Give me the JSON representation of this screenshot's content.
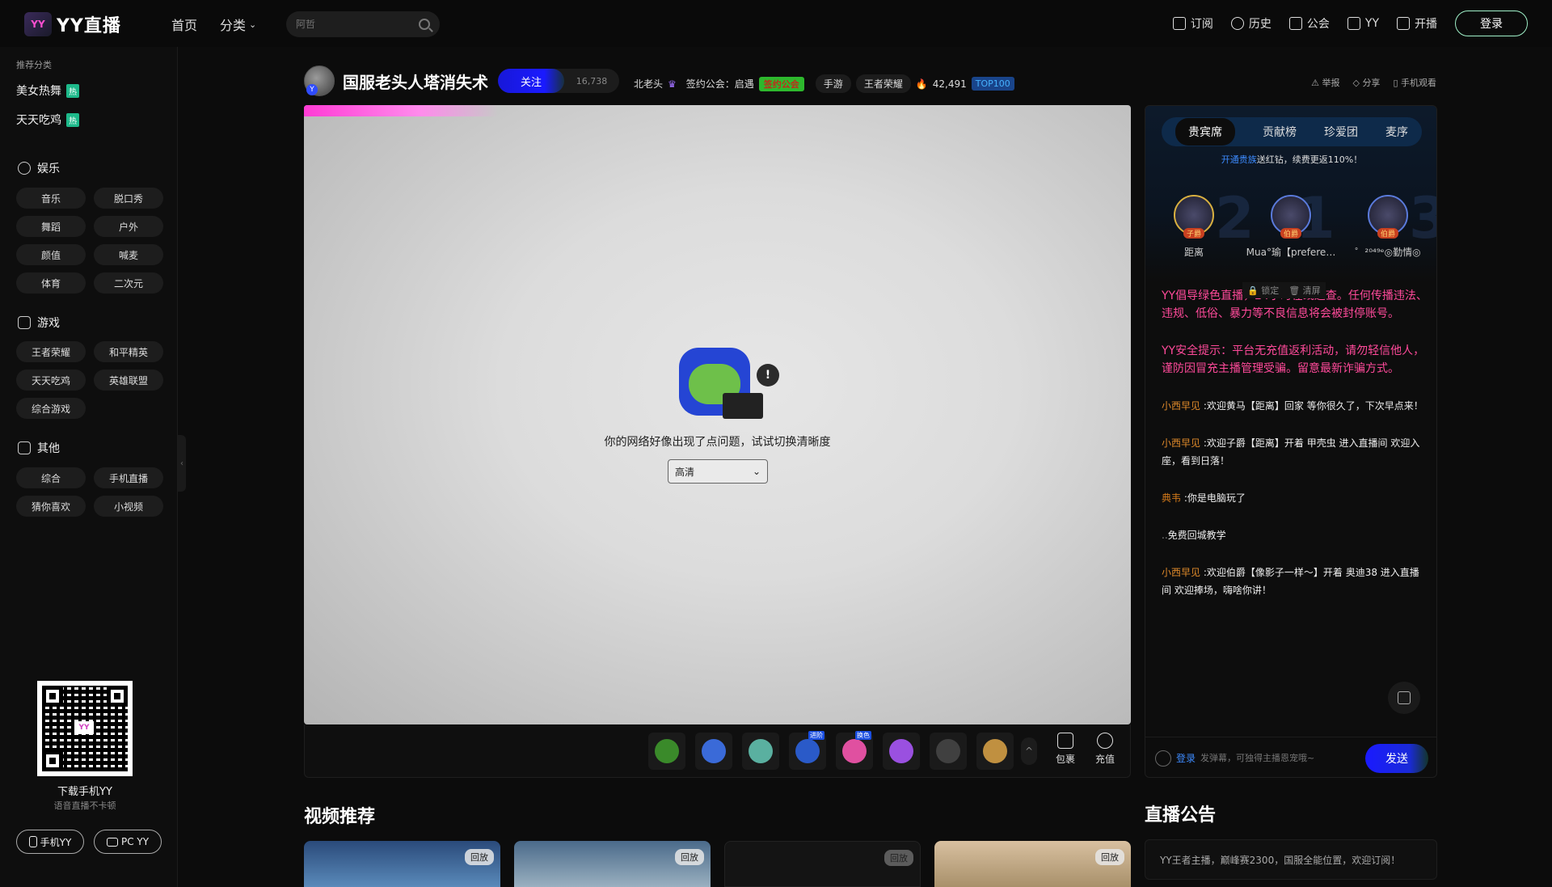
{
  "header": {
    "logo_text": "YY直播",
    "logo_mark": "YY",
    "nav": [
      "首页",
      "分类"
    ],
    "search_placeholder": "阿哲",
    "links": [
      "订阅",
      "历史",
      "公会",
      "YY",
      "开播"
    ],
    "login_label": "登录"
  },
  "sidebar": {
    "recommend_title": "推荐分类",
    "recommend": [
      {
        "label": "美女热舞",
        "badge": "热"
      },
      {
        "label": "天天吃鸡",
        "badge": "热"
      }
    ],
    "groups": [
      {
        "title": "娱乐",
        "items": [
          "音乐",
          "脱口秀",
          "舞蹈",
          "户外",
          "颜值",
          "喊麦",
          "体育",
          "二次元"
        ]
      },
      {
        "title": "游戏",
        "items": [
          "王者荣耀",
          "和平精英",
          "天天吃鸡",
          "英雄联盟",
          "综合游戏"
        ]
      },
      {
        "title": "其他",
        "items": [
          "综合",
          "手机直播",
          "猜你喜欢",
          "小视频"
        ]
      }
    ],
    "qr_label": "YY",
    "download_title": "下载手机YY",
    "download_sub": "语音直播不卡顿",
    "app_buttons": [
      "手机YY",
      "PC YY"
    ]
  },
  "room": {
    "title": "国服老头人塔消失术",
    "follow_label": "关注",
    "follow_count": "16,738",
    "host_name": "北老头",
    "guild_label": "签约公会：启遇",
    "guild_tag": "签约公会",
    "tags": [
      "手游",
      "王者荣耀"
    ],
    "heat": "42,491",
    "rank_badge": "TOP100",
    "actions": [
      "举报",
      "分享",
      "手机观看"
    ]
  },
  "player": {
    "error_message": "你的网络好像出现了点问题，试试切换清晰度",
    "quality_selected": "高清",
    "mascot_bang": "!"
  },
  "gift_bar": {
    "gifts": [
      {
        "name": "gift-1",
        "color": "#3a8a2a",
        "tag": ""
      },
      {
        "name": "gift-2",
        "color": "#3a6ad8",
        "tag": ""
      },
      {
        "name": "gift-3",
        "color": "#5ab0a0",
        "tag": ""
      },
      {
        "name": "gift-4",
        "color": "#2a5ac8",
        "tag": "进阶"
      },
      {
        "name": "gift-5",
        "color": "#e050a0",
        "tag": "换色"
      },
      {
        "name": "gift-6",
        "color": "#9a50e0",
        "tag": ""
      },
      {
        "name": "gift-7",
        "color": "#404040",
        "tag": ""
      },
      {
        "name": "gift-8",
        "color": "#c09040",
        "tag": ""
      }
    ],
    "more_icon": "^",
    "tools": [
      "包裹",
      "充值"
    ]
  },
  "right_panel": {
    "tabs": [
      "贵宾席",
      "贡献榜",
      "珍爱团",
      "麦序"
    ],
    "active_tab": "贵宾席",
    "vip_tip_link": "开通贵族",
    "vip_tip_rest": "送红钻，续费更返110%！",
    "rank_numbers": [
      "2",
      "1",
      "3"
    ],
    "seats": [
      {
        "name": "距离",
        "badge": "子爵"
      },
      {
        "name": "Mua°瑜【prefere…",
        "badge": "伯爵"
      },
      {
        "name": "゜²⁰⁴⁹ᵉ◎勤情◎",
        "badge": "伯爵"
      }
    ],
    "lock_label": "锁定",
    "clear_label": "清屏",
    "system_messages": [
      "YY倡导绿色直播，24小时在线巡查。任何传播违法、违规、低俗、暴力等不良信息将会被封停账号。",
      "YY安全提示：平台无充值返利活动，请勿轻信他人，谨防因冒充主播管理受骗。留意最新诈骗方式。"
    ],
    "messages": [
      {
        "nick": "小西早见",
        "text": "欢迎黄马【距离】回家 等你很久了，下次早点来！"
      },
      {
        "nick": "小西早见",
        "text": "欢迎子爵【距离】开着 甲壳虫 进入直播间 欢迎入座，看到日落！"
      },
      {
        "nick": "典韦",
        "text": "你是电脑玩了"
      },
      {
        "nick": "..",
        "text": "免费回城教学"
      },
      {
        "nick": "小西早见",
        "text": "欢迎伯爵【像影子一样～】开着 奥迪38 进入直播间 欢迎捧场，嗨啥你讲！"
      }
    ],
    "send_login": "登录",
    "send_placeholder": "发弹幕，可独得主播恩宠哦~",
    "send_label": "发送"
  },
  "video_section": {
    "title": "视频推荐",
    "cards": [
      {
        "badge": "回放",
        "color": "#3a5a8a"
      },
      {
        "badge": "回放",
        "color": "#5a7a9a"
      },
      {
        "badge": "回放",
        "color": "#141414"
      },
      {
        "badge": "回放",
        "color": "#c8b090"
      }
    ]
  },
  "notice_section": {
    "title": "直播公告",
    "text": "YY王者主播，巅峰赛2300，国服全能位置，欢迎订阅！"
  }
}
